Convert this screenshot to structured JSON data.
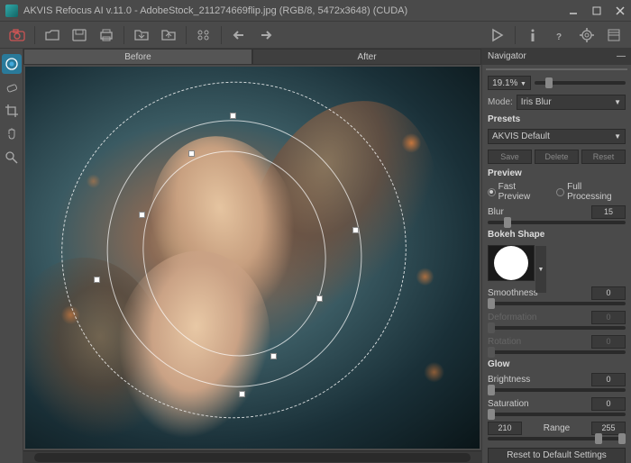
{
  "titlebar": {
    "text": "AKVIS Refocus AI v.11.0  -  AdobeStock_211274669flip.jpg  (RGB/8, 5472x3648)  (CUDA)"
  },
  "tabs": {
    "before": "Before",
    "after": "After"
  },
  "navigator": {
    "title": "Navigator",
    "zoom": "19.1%"
  },
  "mode": {
    "label": "Mode:",
    "value": "Iris Blur"
  },
  "presets": {
    "label": "Presets",
    "value": "AKVIS Default",
    "save": "Save",
    "delete": "Delete",
    "reset": "Reset"
  },
  "preview": {
    "label": "Preview",
    "fast": "Fast Preview",
    "full": "Full Processing"
  },
  "params": {
    "blur_label": "Blur",
    "blur_value": "15",
    "bokeh_label": "Bokeh Shape",
    "smoothness_label": "Smoothness",
    "smoothness_value": "0",
    "deformation_label": "Deformation",
    "deformation_value": "0",
    "rotation_label": "Rotation",
    "rotation_value": "0",
    "glow_label": "Glow",
    "brightness_label": "Brightness",
    "brightness_value": "0",
    "saturation_label": "Saturation",
    "saturation_value": "0",
    "range_from": "210",
    "range_label": "Range",
    "range_to": "255"
  },
  "reset": "Reset to Default Settings"
}
